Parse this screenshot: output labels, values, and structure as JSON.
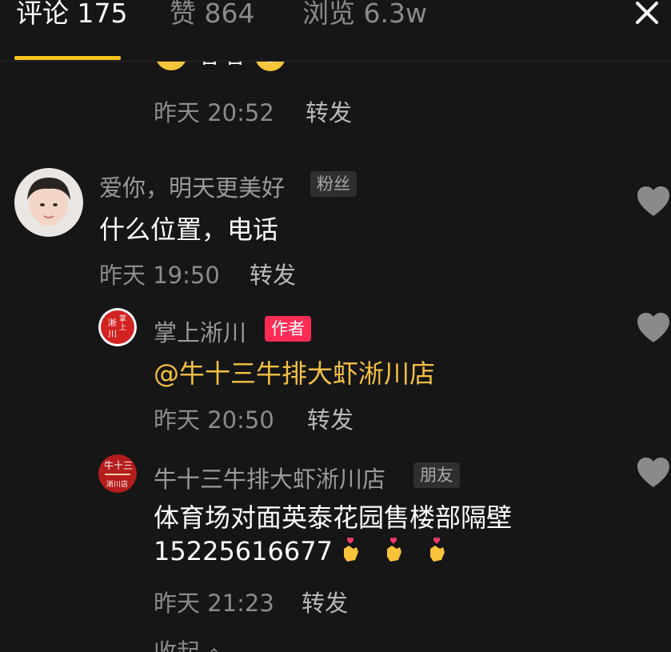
{
  "header": {
    "tabs": [
      {
        "label": "评论 175",
        "active": true
      },
      {
        "label": "赞 864",
        "active": false
      },
      {
        "label": "浏览 6.3w",
        "active": false
      }
    ],
    "accent_color": "#f6c31c"
  },
  "comments": [
    {
      "partial_text": "嘻嘻",
      "time": "昨天 20:52",
      "reply_label": "转发"
    },
    {
      "author": "爱你，明天更美好",
      "badge": "粉丝",
      "text": "什么位置，电话",
      "time": "昨天 19:50",
      "reply_label": "转发"
    },
    {
      "author": "掌上淅川",
      "badge": "作者",
      "mention": "@牛十三牛排大虾淅川店",
      "time": "昨天 20:50",
      "reply_label": "转发",
      "avatar_text": "掌上淅川"
    },
    {
      "author": "牛十三牛排大虾淅川店",
      "badge": "朋友",
      "text_line1": "体育场对面英泰花园售楼部隔壁",
      "text_line2": "15225616677",
      "emojis": [
        "finger-heart-icon",
        "finger-heart-icon",
        "finger-heart-icon"
      ],
      "time": "昨天 21:23",
      "reply_label": "转发",
      "avatar_text": "牛十三"
    }
  ],
  "collapse_label": "收起"
}
